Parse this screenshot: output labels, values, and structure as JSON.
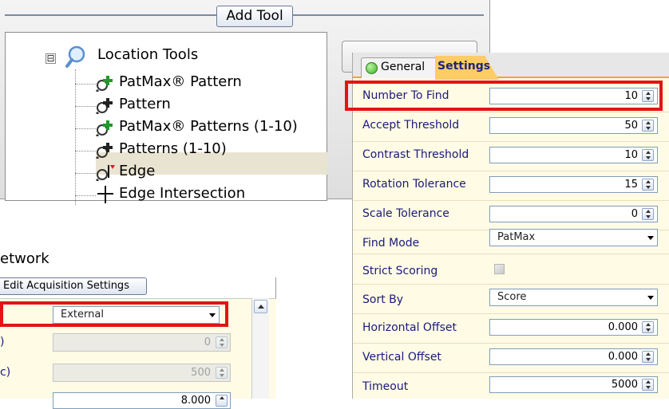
{
  "add_tool": {
    "title": "Add Tool",
    "tree": {
      "root": {
        "label": "Location Tools",
        "expander": "⊟"
      },
      "items": [
        {
          "label": "PatMax® Pattern",
          "icon": "patmax-pattern-icon"
        },
        {
          "label": "Pattern",
          "icon": "pattern-icon"
        },
        {
          "label": "PatMax® Patterns (1-10)",
          "icon": "patmax-patterns-icon",
          "selected": true
        },
        {
          "label": "Patterns (1-10)",
          "icon": "patterns-icon"
        },
        {
          "label": "Edge",
          "icon": "edge-icon"
        },
        {
          "label": "Edge Intersection",
          "icon": "edge-intersection-icon"
        }
      ]
    }
  },
  "settings_panel": {
    "tabs": [
      {
        "label": "General",
        "status": "green"
      },
      {
        "label": "Settings",
        "active": true
      }
    ],
    "rows": [
      {
        "label": "Number To Find",
        "type": "number",
        "value": "10",
        "highlighted": true
      },
      {
        "label": "Accept Threshold",
        "type": "number",
        "value": "50"
      },
      {
        "label": "Contrast Threshold",
        "type": "number",
        "value": "10"
      },
      {
        "label": "Rotation Tolerance",
        "type": "number",
        "value": "15"
      },
      {
        "label": "Scale Tolerance",
        "type": "number",
        "value": "0"
      },
      {
        "label": "Find Mode",
        "type": "select",
        "value": "PatMax"
      },
      {
        "label": "Strict Scoring",
        "type": "checkbox",
        "checked": false,
        "disabled": true
      },
      {
        "label": "Sort By",
        "type": "select",
        "value": "Score"
      },
      {
        "label": "Horizontal Offset",
        "type": "number",
        "value": "0.000"
      },
      {
        "label": "Vertical Offset",
        "type": "number",
        "value": "0.000"
      },
      {
        "label": "Timeout",
        "type": "number",
        "value": "5000"
      }
    ]
  },
  "network": {
    "label": "etwork",
    "tab": "Edit Acquisition Settings",
    "rows": [
      {
        "label": "",
        "type": "select",
        "value": "External",
        "highlighted": true
      },
      {
        "label": ")",
        "type": "number",
        "value": "0",
        "disabled": true
      },
      {
        "label": "c)",
        "type": "number",
        "value": "500",
        "disabled": true
      },
      {
        "label": "",
        "type": "number",
        "value": "8.000",
        "disabled": false
      }
    ]
  },
  "colors": {
    "highlight": "#e31414",
    "active_tab": "#ffcc66",
    "label_text": "#1a1a7a",
    "selection": "#e9e4d1",
    "panel_bg": "#fffbe5"
  }
}
